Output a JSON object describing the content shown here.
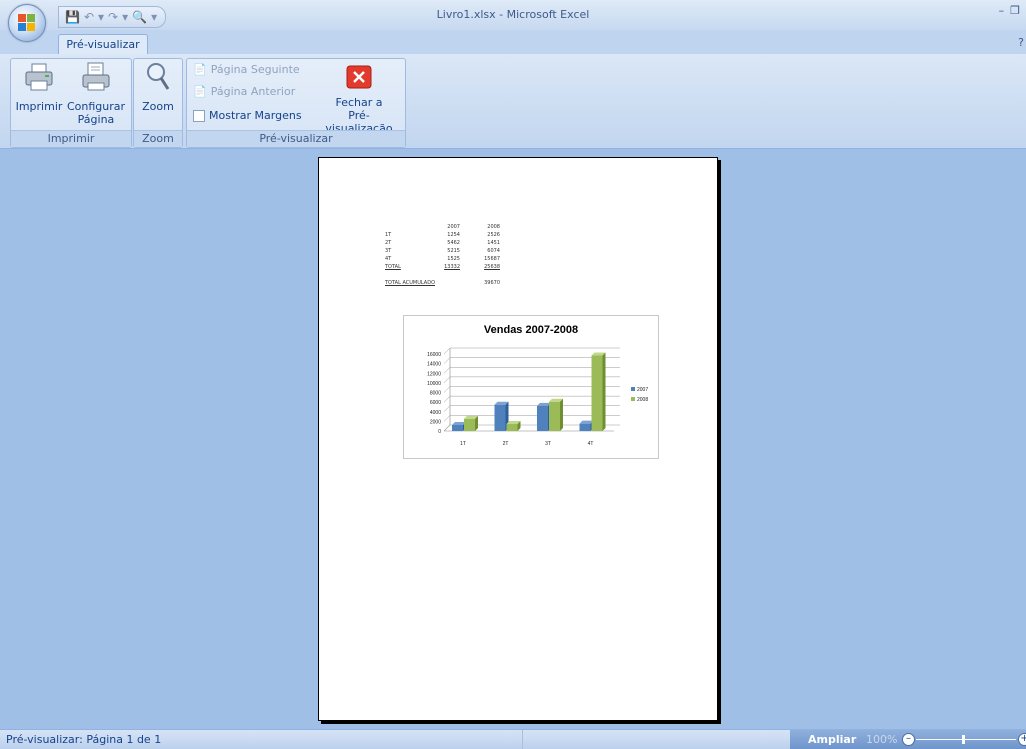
{
  "window": {
    "title": "Livro1.xlsx - Microsoft Excel"
  },
  "ribbon": {
    "active_tab": "Pré-visualizar",
    "groups": {
      "imprimir": {
        "label": "Imprimir",
        "print_label": "Imprimir",
        "setup_label_1": "Configurar",
        "setup_label_2": "Página"
      },
      "zoom": {
        "label": "Zoom",
        "zoom_label": "Zoom"
      },
      "preview": {
        "label": "Pré-visualizar",
        "next_label": "Página Seguinte",
        "prev_label": "Página Anterior",
        "margins_label": "Mostrar Margens",
        "close_label_1": "Fechar a",
        "close_label_2": "Pré-visualização"
      }
    }
  },
  "sheet": {
    "headers": [
      "",
      "2007",
      "2008"
    ],
    "rows": [
      [
        "1T",
        "1254",
        "2526"
      ],
      [
        "2T",
        "5462",
        "1451"
      ],
      [
        "3T",
        "5215",
        "6074"
      ],
      [
        "4T",
        "1525",
        "15687"
      ]
    ],
    "total": [
      "TOTAL",
      "13332",
      "25638"
    ],
    "accumulated": [
      "TOTAL ACUMULADO",
      "39670"
    ]
  },
  "chart_data": {
    "type": "bar",
    "title": "Vendas 2007-2008",
    "categories": [
      "1T",
      "2T",
      "3T",
      "4T"
    ],
    "series": [
      {
        "name": "2007",
        "values": [
          1254,
          5462,
          5215,
          1525
        ]
      },
      {
        "name": "2008",
        "values": [
          2526,
          1451,
          6074,
          15687
        ]
      }
    ],
    "ylim": [
      0,
      16000
    ],
    "yticks": [
      "0",
      "2000",
      "4000",
      "6000",
      "8000",
      "10000",
      "12000",
      "14000",
      "16000"
    ],
    "legend": "right",
    "colors": {
      "2007": "#4f81bd",
      "2008": "#9bbb59"
    }
  },
  "statusbar": {
    "text": "Pré-visualizar: Página 1 de 1",
    "zoom_label": "Ampliar",
    "zoom_value": "100%"
  }
}
